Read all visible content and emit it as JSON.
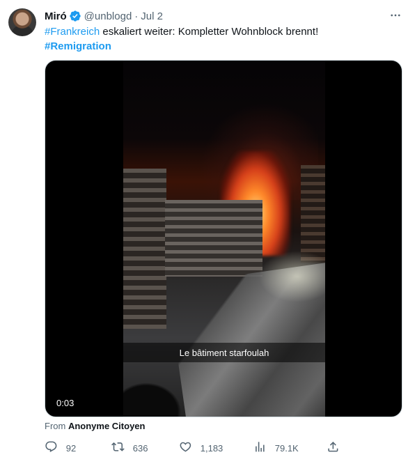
{
  "author": {
    "name": "Miró",
    "handle": "@unblogd",
    "separator": "·",
    "date": "Jul 2"
  },
  "tweet": {
    "hashtag1": "#Frankreich",
    "text": " eskaliert weiter: Kompletter Wohnblock brennt!",
    "hashtag2": "#Remigration"
  },
  "media": {
    "subtitle": "Le bâtiment starfoulah",
    "duration": "0:03"
  },
  "source": {
    "prefix": "From ",
    "name": "Anonyme Citoyen"
  },
  "actions": {
    "replies": "92",
    "retweets": "636",
    "likes": "1,183",
    "views": "79.1K"
  },
  "icons": {
    "verified": "verified-badge-icon",
    "more": "more-icon",
    "reply": "reply-icon",
    "retweet": "retweet-icon",
    "like": "heart-icon",
    "views": "views-icon",
    "share": "share-icon"
  },
  "colors": {
    "accent": "#1d9bf0",
    "text": "#0f1419",
    "secondary": "#536471"
  }
}
